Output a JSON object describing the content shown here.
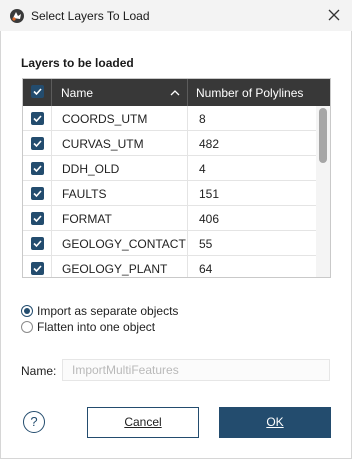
{
  "window": {
    "title": "Select Layers To Load"
  },
  "layers": {
    "section_title": "Layers to be loaded",
    "columns": {
      "name": "Name",
      "count": "Number of Polylines"
    },
    "all_checked": true,
    "rows": [
      {
        "name": "COORDS_UTM",
        "count": "8",
        "checked": true
      },
      {
        "name": "CURVAS_UTM",
        "count": "482",
        "checked": true
      },
      {
        "name": "DDH_OLD",
        "count": "4",
        "checked": true
      },
      {
        "name": "FAULTS",
        "count": "151",
        "checked": true
      },
      {
        "name": "FORMAT",
        "count": "406",
        "checked": true
      },
      {
        "name": "GEOLOGY_CONTACT",
        "count": "55",
        "checked": true
      },
      {
        "name": "GEOLOGY_PLANT",
        "count": "64",
        "checked": true
      }
    ]
  },
  "import_mode": {
    "options": [
      {
        "label": "Import as separate objects",
        "selected": true
      },
      {
        "label": "Flatten into one object",
        "selected": false
      }
    ]
  },
  "name_field": {
    "label": "Name:",
    "placeholder": "ImportMultiFeatures",
    "value": ""
  },
  "buttons": {
    "help": "?",
    "cancel": "Cancel",
    "ok": "OK"
  },
  "colors": {
    "accent": "#234c6e",
    "header_bg": "#383838"
  },
  "icons": {
    "app": "leapfrog-app-icon",
    "close": "close-icon",
    "sort": "chevron-up-icon",
    "check": "checkmark-icon",
    "help": "help-icon"
  }
}
